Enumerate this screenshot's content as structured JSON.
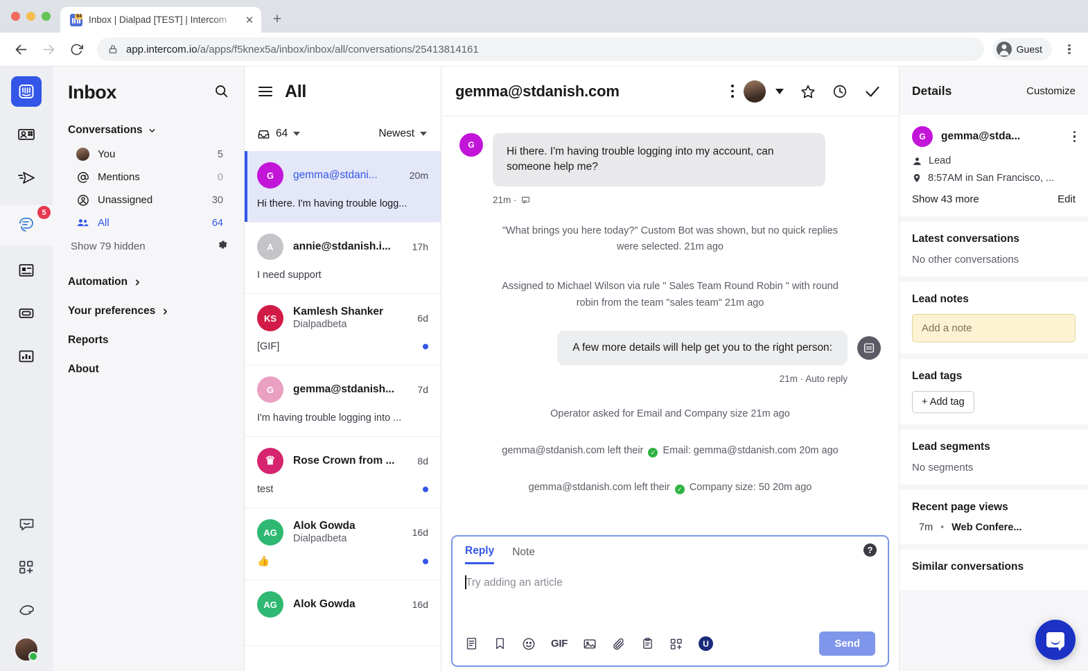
{
  "browser": {
    "tab_title": "Inbox | Dialpad [TEST] | Intercom",
    "favicon_badge": "64",
    "url_domain": "app.intercom.io",
    "url_path": "/a/apps/f5knex5a/inbox/inbox/all/conversations/25413814161",
    "profile_label": "Guest",
    "new_tab_label": "+",
    "close_tab_label": "✕"
  },
  "rail": {
    "items": [
      {
        "name": "intercom-logo",
        "badge": ""
      },
      {
        "name": "contacts",
        "badge": ""
      },
      {
        "name": "outbound",
        "badge": ""
      },
      {
        "name": "inbox",
        "badge": "5"
      },
      {
        "name": "articles",
        "badge": ""
      },
      {
        "name": "knowledge",
        "badge": ""
      },
      {
        "name": "reports",
        "badge": ""
      }
    ],
    "bottom": [
      {
        "name": "messenger"
      },
      {
        "name": "apps"
      },
      {
        "name": "whats-new"
      }
    ]
  },
  "sidebar": {
    "title": "Inbox",
    "search_icon": "search-icon",
    "group_label": "Conversations",
    "items": [
      {
        "label": "You",
        "count": "5",
        "icon": "avatar",
        "selected": false
      },
      {
        "label": "Mentions",
        "count": "0",
        "icon": "at-icon",
        "selected": false
      },
      {
        "label": "Unassigned",
        "count": "30",
        "icon": "unassigned-icon",
        "selected": false
      },
      {
        "label": "All",
        "count": "64",
        "icon": "team-icon",
        "selected": true
      }
    ],
    "show_hidden": "Show 79 hidden",
    "links": [
      {
        "label": "Automation",
        "chevron": true
      },
      {
        "label": "Your preferences",
        "chevron": true
      },
      {
        "label": "Reports",
        "chevron": false
      },
      {
        "label": "About",
        "chevron": false
      }
    ]
  },
  "conversation_list": {
    "title": "All",
    "count": "64",
    "sort_label": "Newest",
    "items": [
      {
        "name": "gemma@stdani...",
        "subtitle": "",
        "time": "20m",
        "preview": "Hi there. I'm having trouble logg...",
        "avatar_letter": "G",
        "avatar_color": "#c215d8",
        "active": true,
        "unread": false
      },
      {
        "name": "annie@stdanish.i...",
        "subtitle": "",
        "time": "17h",
        "preview": "I need support",
        "avatar_letter": "A",
        "avatar_color": "#c4c4c9",
        "active": false,
        "unread": false
      },
      {
        "name": "Kamlesh Shanker",
        "subtitle": "Dialpadbeta",
        "time": "6d",
        "preview": "[GIF]",
        "avatar_letter": "KS",
        "avatar_color": "#d11b46",
        "active": false,
        "unread": true
      },
      {
        "name": "gemma@stdanish...",
        "subtitle": "",
        "time": "7d",
        "preview": "I'm having trouble logging into ...",
        "avatar_letter": "G",
        "avatar_color": "#eaa0c0",
        "active": false,
        "unread": false
      },
      {
        "name": "Rose Crown from ...",
        "subtitle": "",
        "time": "8d",
        "preview": "test",
        "avatar_letter": "♛",
        "avatar_color": "#d6246e",
        "active": false,
        "unread": true
      },
      {
        "name": "Alok Gowda",
        "subtitle": "Dialpadbeta",
        "time": "16d",
        "preview": "👍",
        "avatar_letter": "AG",
        "avatar_color": "#2eb872",
        "active": false,
        "unread": true
      },
      {
        "name": "Alok Gowda",
        "subtitle": "",
        "time": "16d",
        "preview": "",
        "avatar_letter": "AG",
        "avatar_color": "#2eb872",
        "active": false,
        "unread": false
      }
    ]
  },
  "main": {
    "header_title": "gemma@stdanish.com",
    "header_icons": [
      "kebab-icon",
      "assignee-avatar",
      "chevron-down-icon",
      "star-icon",
      "snooze-icon",
      "close-check-icon"
    ],
    "messages": [
      {
        "type": "incoming",
        "avatar_letter": "G",
        "avatar_color": "#c215d8",
        "text": "Hi there. I'm having trouble logging into my account, can someone help me?",
        "meta": "21m ·"
      }
    ],
    "system_notes": [
      "\"What brings you here today?\" Custom Bot was shown, but no quick replies were selected. 21m ago",
      "Assigned to Michael Wilson via rule \" Sales Team Round Robin \" with round robin from the team \"sales team\" 21m ago"
    ],
    "operator_message": {
      "text": "A few more details will help get you to the right person:",
      "meta": "21m · Auto reply"
    },
    "system_notes_2": [
      "Operator asked for Email and Company size 21m ago"
    ],
    "attribute_notes": [
      {
        "prefix": "gemma@stdanish.com left their",
        "value": "Email: gemma@stdanish.com 20m ago"
      },
      {
        "prefix": "gemma@stdanish.com left their",
        "value": "Company size: 50 20m ago"
      }
    ]
  },
  "composer": {
    "tabs": [
      {
        "label": "Reply",
        "active": true
      },
      {
        "label": "Note",
        "active": false
      }
    ],
    "placeholder": "Try adding an article",
    "help_icon": "question-mark-icon",
    "toolbar_icons": [
      "article-icon",
      "saved-reply-icon",
      "emoji-icon",
      "gif-icon",
      "image-icon",
      "attachment-icon",
      "clipboard-icon",
      "apps-icon",
      "unsplash-icon"
    ],
    "gif_label": "GIF",
    "unsplash_label": "U",
    "send_label": "Send"
  },
  "details": {
    "title": "Details",
    "customize_label": "Customize",
    "profile": {
      "name": "gemma@stda...",
      "avatar_letter": "G",
      "avatar_color": "#c215d8",
      "role": "Lead",
      "location": "8:57AM in San Francisco, ...",
      "show_more": "Show 43 more",
      "edit": "Edit"
    },
    "sections": [
      {
        "heading": "Latest conversations",
        "body": "No other conversations"
      },
      {
        "heading": "Lead notes",
        "note_placeholder": "Add a note"
      },
      {
        "heading": "Lead tags",
        "add_tag": "+ Add tag"
      },
      {
        "heading": "Lead segments",
        "body": "No segments"
      },
      {
        "heading": "Recent page views",
        "page_time": "7m",
        "page_name": "Web Confere..."
      },
      {
        "heading": "Similar conversations"
      }
    ]
  },
  "colors": {
    "brand_blue": "#3355e8",
    "badge_red": "#e8384f",
    "send_button": "#8096eb",
    "selected_row": "#e4e7f8",
    "note_yellow": "#fdf3d3",
    "fab_blue": "#1c32c4",
    "green_check": "#2fb344"
  }
}
